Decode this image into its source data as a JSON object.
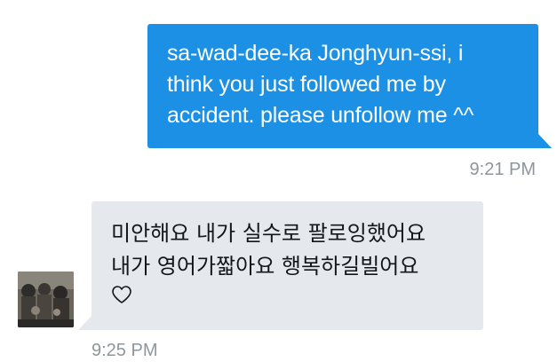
{
  "messages": [
    {
      "direction": "sent",
      "text": "sa-wad-dee-ka Jonghyun-ssi, i\nthink you just followed me by\naccident. please unfollow me ^^",
      "time": "9:21 PM"
    },
    {
      "direction": "received",
      "text": "미안해요 내가 실수로 팔로잉했어요\n내가 영어가짧아요 행복하길빌어요",
      "icon": "heart-outline-icon",
      "time": "9:25 PM"
    }
  ],
  "colors": {
    "sent_bubble": "#1b90e4",
    "received_bubble": "#e5e9ed",
    "timestamp": "#8e969c"
  }
}
